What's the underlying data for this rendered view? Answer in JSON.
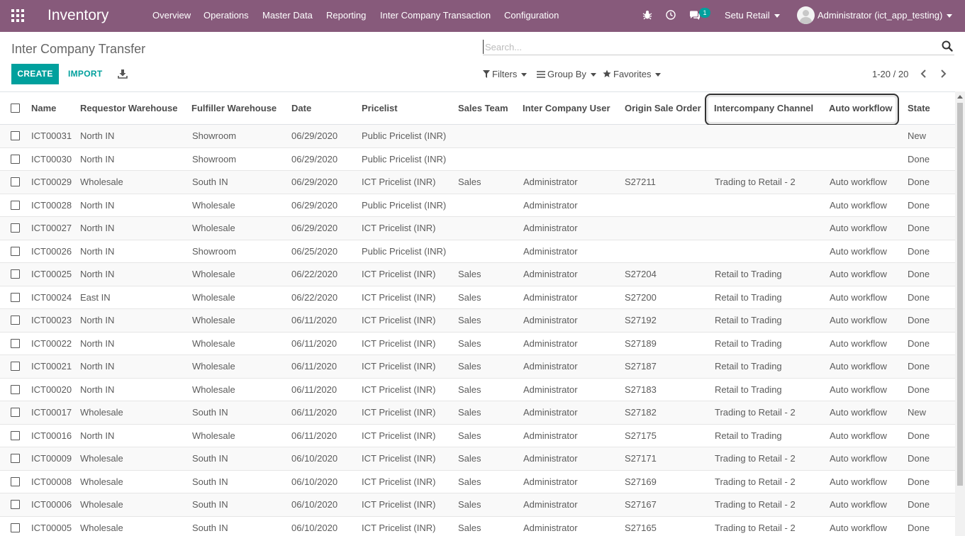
{
  "navbar": {
    "app_name": "Inventory",
    "menu": [
      "Overview",
      "Operations",
      "Master Data",
      "Reporting",
      "Inter Company Transaction",
      "Configuration"
    ],
    "messages_badge": "1",
    "company": "Setu Retail",
    "user": "Administrator (ict_app_testing)"
  },
  "control_panel": {
    "breadcrumb": "Inter Company Transfer",
    "search_placeholder": "Search...",
    "create_label": "CREATE",
    "import_label": "IMPORT",
    "filters_label": "Filters",
    "groupby_label": "Group By",
    "favorites_label": "Favorites",
    "pager": "1-20 / 20"
  },
  "table": {
    "columns": [
      "Name",
      "Requestor Warehouse",
      "Fulfiller Warehouse",
      "Date",
      "Pricelist",
      "Sales Team",
      "Inter Company User",
      "Origin Sale Order",
      "Intercompany Channel",
      "Auto workflow",
      "State"
    ],
    "rows": [
      [
        "ICT00031",
        "North IN",
        "Showroom",
        "06/29/2020",
        "Public Pricelist (INR)",
        "",
        "",
        "",
        "",
        "",
        "New"
      ],
      [
        "ICT00030",
        "North IN",
        "Showroom",
        "06/29/2020",
        "Public Pricelist (INR)",
        "",
        "",
        "",
        "",
        "",
        "Done"
      ],
      [
        "ICT00029",
        "Wholesale",
        "South IN",
        "06/29/2020",
        "ICT Pricelist (INR)",
        "Sales",
        "Administrator",
        "S27211",
        "Trading to Retail - 2",
        "Auto workflow",
        "Done"
      ],
      [
        "ICT00028",
        "North IN",
        "Wholesale",
        "06/29/2020",
        "Public Pricelist (INR)",
        "",
        "Administrator",
        "",
        "",
        "Auto workflow",
        "Done"
      ],
      [
        "ICT00027",
        "North IN",
        "Wholesale",
        "06/29/2020",
        "ICT Pricelist (INR)",
        "",
        "Administrator",
        "",
        "",
        "Auto workflow",
        "Done"
      ],
      [
        "ICT00026",
        "North IN",
        "Showroom",
        "06/25/2020",
        "Public Pricelist (INR)",
        "",
        "Administrator",
        "",
        "",
        "Auto workflow",
        "Done"
      ],
      [
        "ICT00025",
        "North IN",
        "Wholesale",
        "06/22/2020",
        "ICT Pricelist (INR)",
        "Sales",
        "Administrator",
        "S27204",
        "Retail to Trading",
        "Auto workflow",
        "Done"
      ],
      [
        "ICT00024",
        "East IN",
        "Wholesale",
        "06/22/2020",
        "ICT Pricelist (INR)",
        "Sales",
        "Administrator",
        "S27200",
        "Retail to Trading",
        "Auto workflow",
        "Done"
      ],
      [
        "ICT00023",
        "North IN",
        "Wholesale",
        "06/11/2020",
        "ICT Pricelist (INR)",
        "Sales",
        "Administrator",
        "S27192",
        "Retail to Trading",
        "Auto workflow",
        "Done"
      ],
      [
        "ICT00022",
        "North IN",
        "Wholesale",
        "06/11/2020",
        "ICT Pricelist (INR)",
        "Sales",
        "Administrator",
        "S27189",
        "Retail to Trading",
        "Auto workflow",
        "Done"
      ],
      [
        "ICT00021",
        "North IN",
        "Wholesale",
        "06/11/2020",
        "ICT Pricelist (INR)",
        "Sales",
        "Administrator",
        "S27187",
        "Retail to Trading",
        "Auto workflow",
        "Done"
      ],
      [
        "ICT00020",
        "North IN",
        "Wholesale",
        "06/11/2020",
        "ICT Pricelist (INR)",
        "Sales",
        "Administrator",
        "S27183",
        "Retail to Trading",
        "Auto workflow",
        "Done"
      ],
      [
        "ICT00017",
        "Wholesale",
        "South IN",
        "06/11/2020",
        "ICT Pricelist (INR)",
        "Sales",
        "Administrator",
        "S27182",
        "Trading to Retail - 2",
        "Auto workflow",
        "New"
      ],
      [
        "ICT00016",
        "North IN",
        "Wholesale",
        "06/11/2020",
        "ICT Pricelist (INR)",
        "Sales",
        "Administrator",
        "S27175",
        "Retail to Trading",
        "Auto workflow",
        "Done"
      ],
      [
        "ICT00009",
        "Wholesale",
        "South IN",
        "06/10/2020",
        "ICT Pricelist (INR)",
        "Sales",
        "Administrator",
        "S27171",
        "Trading to Retail - 2",
        "Auto workflow",
        "Done"
      ],
      [
        "ICT00008",
        "Wholesale",
        "South IN",
        "06/10/2020",
        "ICT Pricelist (INR)",
        "Sales",
        "Administrator",
        "S27169",
        "Trading to Retail - 2",
        "Auto workflow",
        "Done"
      ],
      [
        "ICT00006",
        "Wholesale",
        "South IN",
        "06/10/2020",
        "ICT Pricelist (INR)",
        "Sales",
        "Administrator",
        "S27167",
        "Trading to Retail - 2",
        "Auto workflow",
        "Done"
      ],
      [
        "ICT00005",
        "Wholesale",
        "South IN",
        "06/10/2020",
        "ICT Pricelist (INR)",
        "Sales",
        "Administrator",
        "S27165",
        "Trading to Retail - 2",
        "Auto workflow",
        "Done"
      ]
    ]
  },
  "colors": {
    "navbar": "#875a7b",
    "primary": "#00a09d"
  },
  "icons": [
    "apps-icon",
    "bug-icon",
    "clock-icon",
    "chat-icon",
    "search-icon",
    "download-icon",
    "filter-icon",
    "groupby-icon",
    "star-icon",
    "chevron-left-icon",
    "chevron-right-icon"
  ]
}
